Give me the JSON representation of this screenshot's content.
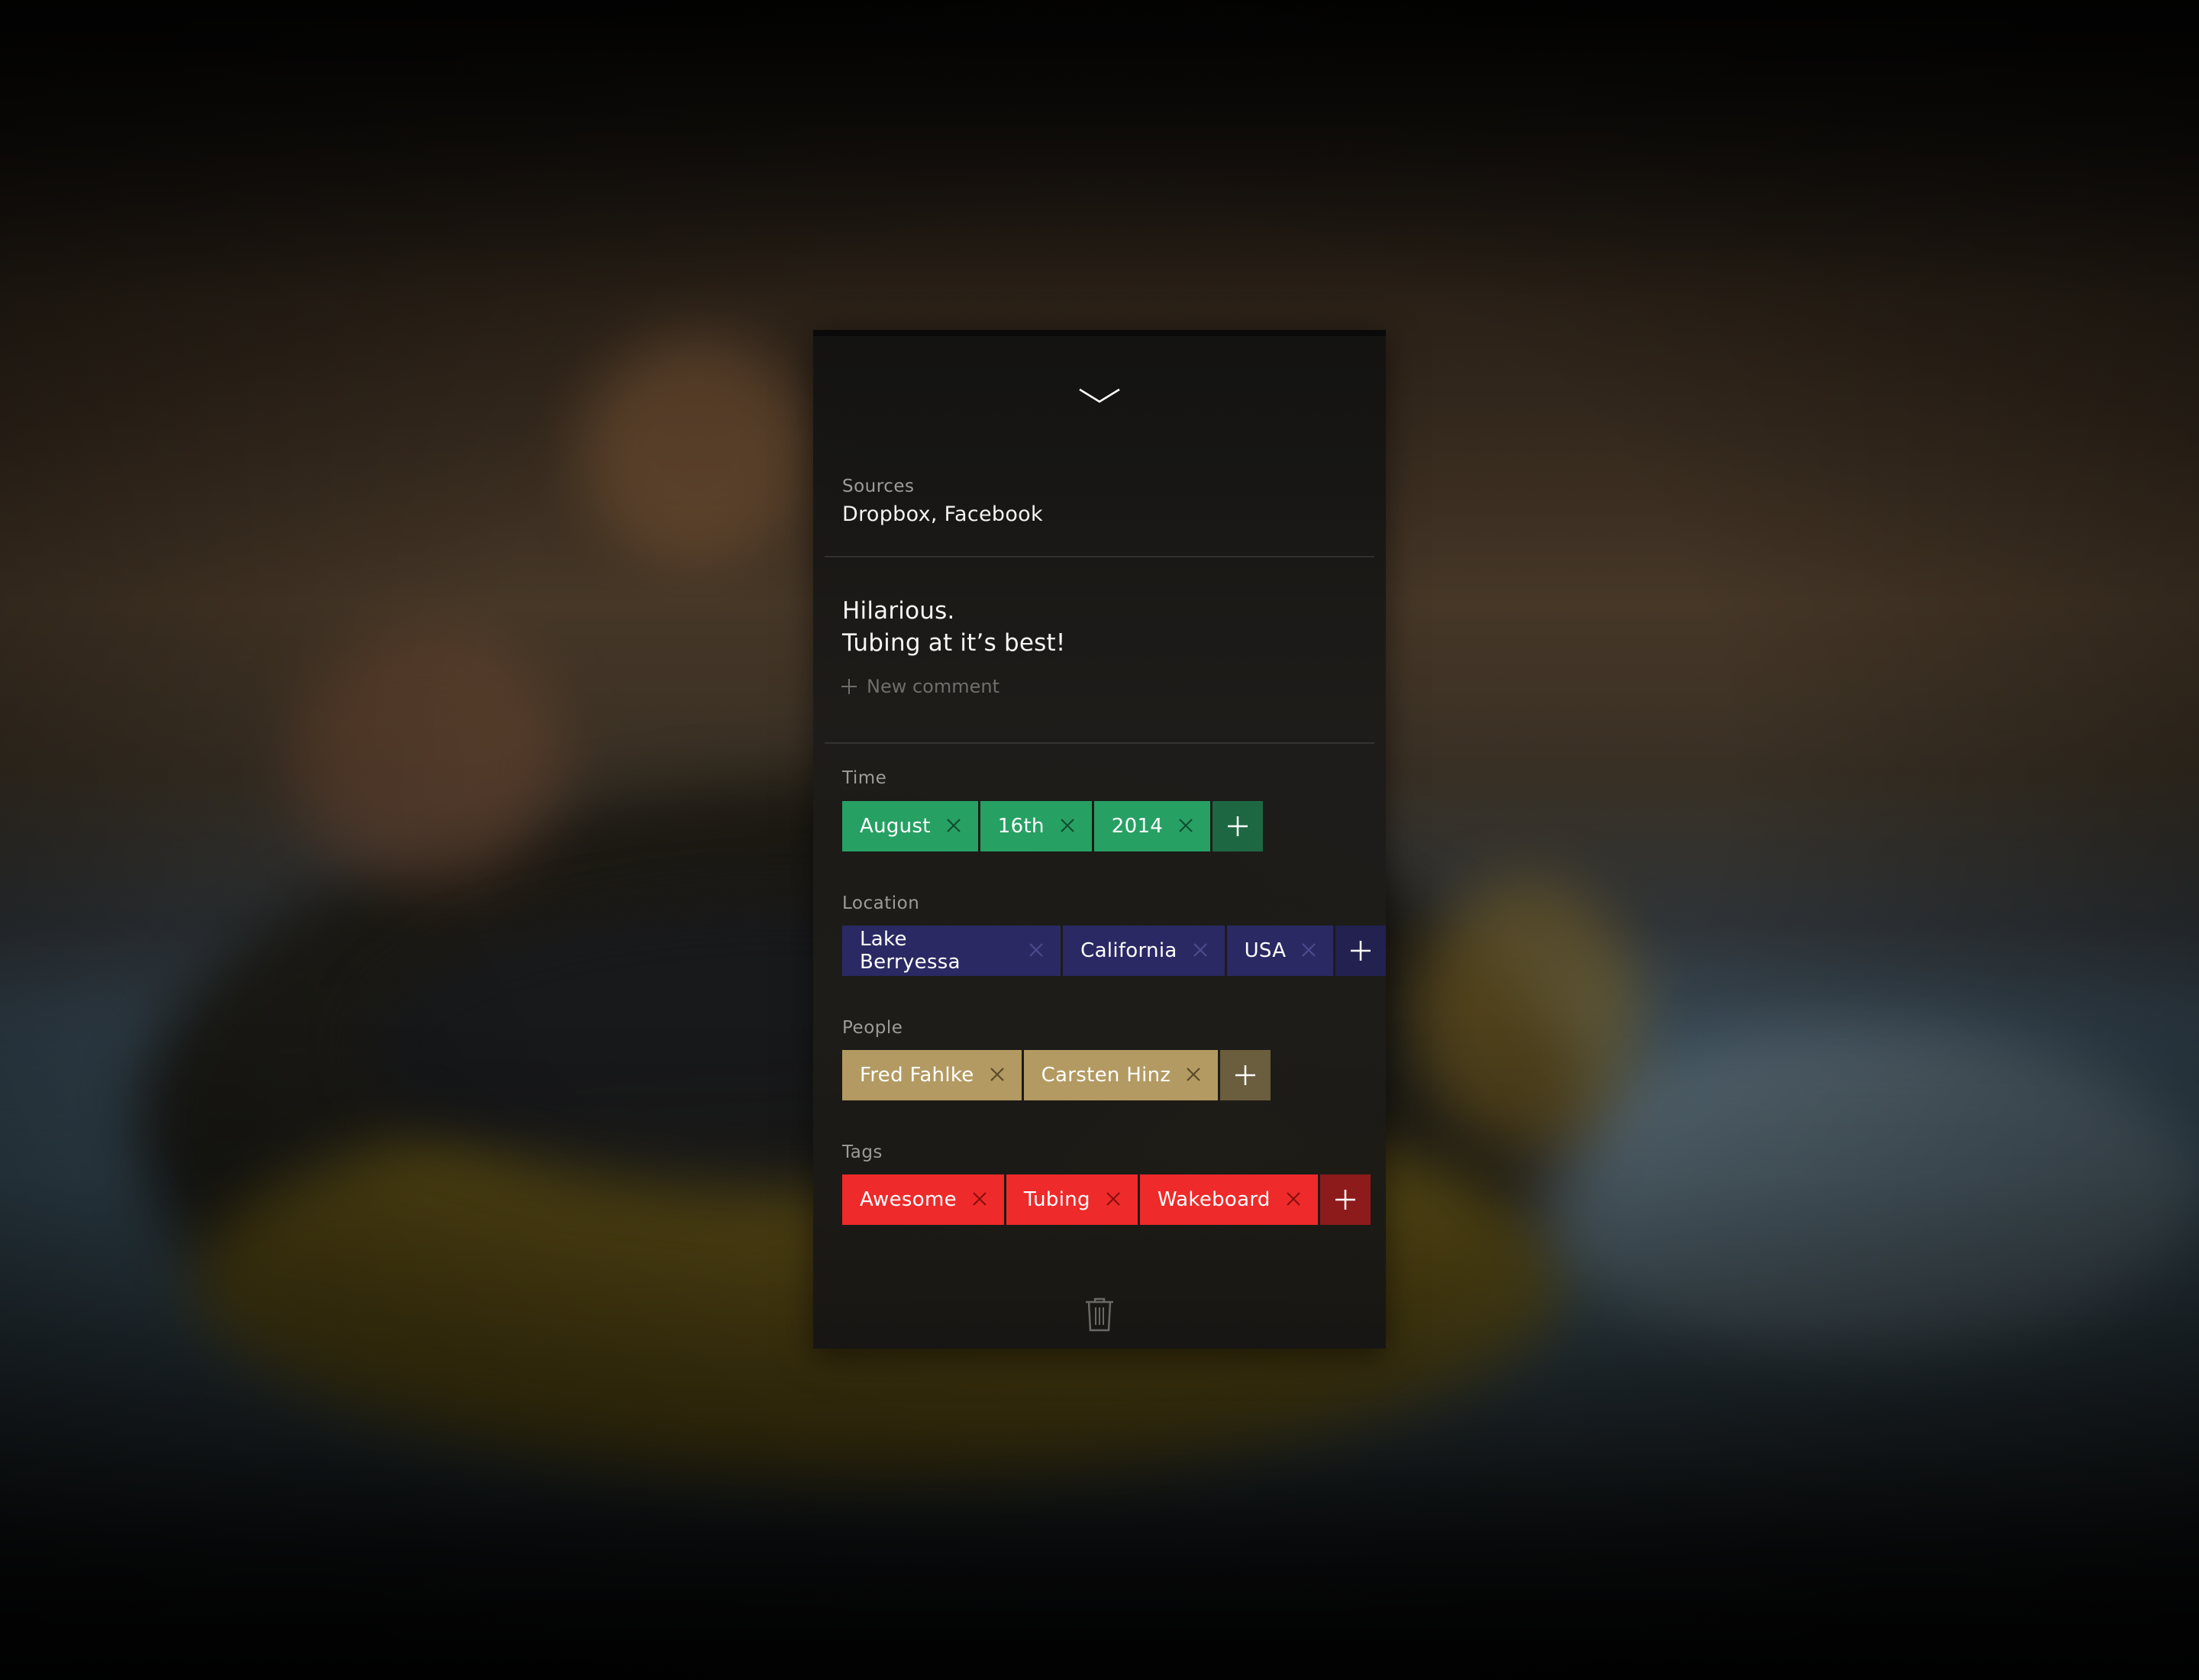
{
  "colors": {
    "time_chip": "#27a064",
    "time_add": "#1d6843",
    "time_x": "#0f4e2e",
    "location_chip": "#2a2963",
    "location_add": "#222150",
    "location_x": "#4c4a8e",
    "people_chip": "#b39a62",
    "people_add": "#6b5e3e",
    "people_x": "#5a4a2a",
    "tags_chip": "#ef2a2a",
    "tags_add": "#8e1b1b",
    "tags_x": "#8a0f0f"
  },
  "panel": {
    "collapse_icon": "chevron-down-icon",
    "sources": {
      "label": "Sources",
      "value": "Dropbox, Facebook"
    },
    "comment": {
      "lines": [
        "Hilarious.",
        "Tubing at it’s best!"
      ],
      "new_comment": "New comment"
    },
    "time": {
      "label": "Time",
      "chips": [
        "August",
        "16th",
        "2014"
      ]
    },
    "location": {
      "label": "Location",
      "chips": [
        "Lake Berryessa",
        "California",
        "USA"
      ]
    },
    "people": {
      "label": "People",
      "chips": [
        "Fred Fahlke",
        "Carsten Hinz"
      ]
    },
    "tags": {
      "label": "Tags",
      "chips": [
        "Awesome",
        "Tubing",
        "Wakeboard"
      ]
    },
    "delete_icon": "trash-icon"
  }
}
